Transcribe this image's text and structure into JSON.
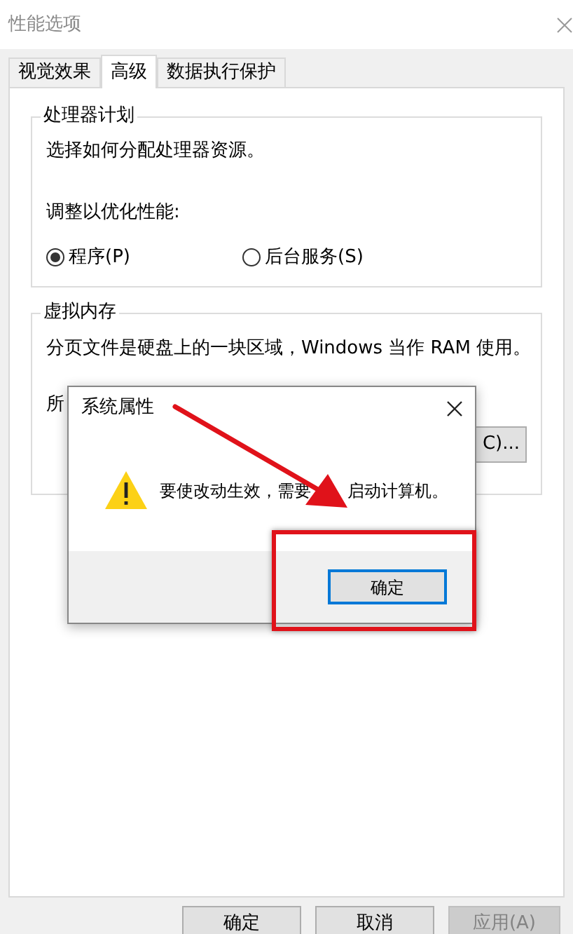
{
  "window": {
    "title": "性能选项"
  },
  "tabs": [
    {
      "label": "视觉效果",
      "selected": false
    },
    {
      "label": "高级",
      "selected": true
    },
    {
      "label": "数据执行保护",
      "selected": false
    }
  ],
  "processor_group": {
    "title": "处理器计划",
    "description": "选择如何分配处理器资源。",
    "prompt": "调整以优化性能:",
    "options": [
      {
        "label": "程序(P)",
        "selected": true
      },
      {
        "label": "后台服务(S)",
        "selected": false
      }
    ]
  },
  "virtual_memory_group": {
    "title": "虚拟内存",
    "description": "分页文件是硬盘上的一块区域，Windows 当作 RAM 使用。",
    "partial_label": "所",
    "change_button": "C)..."
  },
  "dialog": {
    "title": "系统属性",
    "message_parts": [
      "要使改动生效，需要",
      "启动计算机。"
    ],
    "button": "确定"
  },
  "buttons": [
    {
      "label": "确定",
      "disabled": false
    },
    {
      "label": "取消",
      "disabled": false
    },
    {
      "label": "应用(A)",
      "disabled": true
    }
  ]
}
